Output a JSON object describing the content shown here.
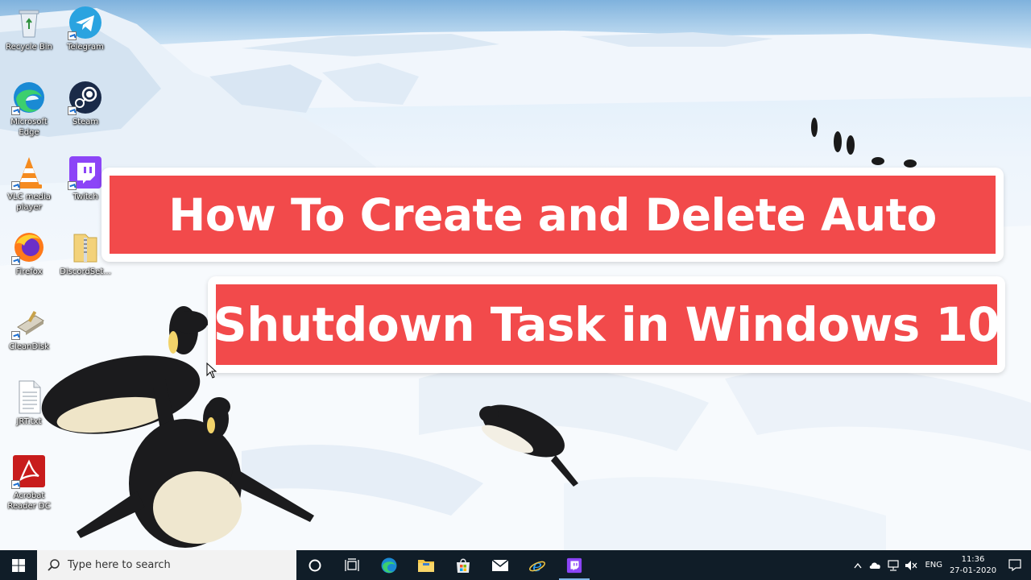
{
  "banner": {
    "line1": "How To Create and Delete Auto",
    "line2": "Shutdown Task in Windows 10"
  },
  "desktop_icons": {
    "recycle_bin": "Recycle Bin",
    "telegram": "Telegram",
    "edge_line1": "Microsoft",
    "edge_line2": "Edge",
    "steam": "Steam",
    "vlc_line1": "VLC media",
    "vlc_line2": "player",
    "twitch": "Twitch",
    "firefox": "Firefox",
    "discord_setup": "DiscordSet...",
    "cleandisk": "CleanDisk",
    "jrt": "JRT.txt",
    "acrobat_line1": "Acrobat",
    "acrobat_line2": "Reader DC"
  },
  "taskbar": {
    "search_placeholder": "Type here to search",
    "pinned": [
      "task-view-icon",
      "edge-icon",
      "file-explorer-icon",
      "store-icon",
      "mail-icon",
      "internet-explorer-icon",
      "twitch-icon"
    ],
    "language": "ENG",
    "time": "11:36",
    "date": "27-01-2020"
  },
  "colors": {
    "banner_red": "#f24a4b",
    "taskbar": "#101d28"
  }
}
